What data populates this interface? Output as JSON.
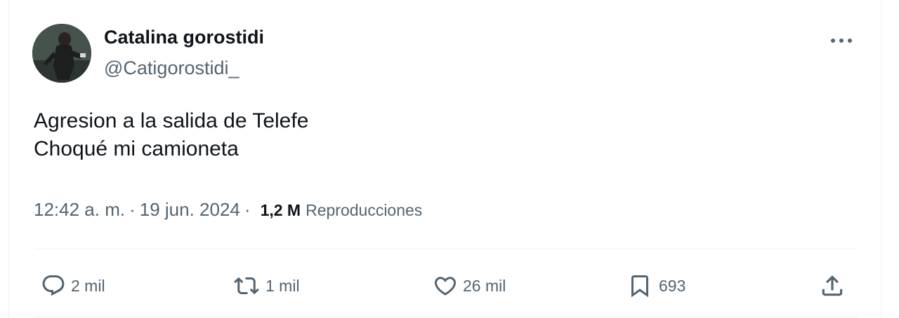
{
  "author": {
    "display_name": "Catalina gorostidi",
    "handle": "@Catigorostidi_"
  },
  "tweet": {
    "lines": [
      "Agresion a la salida de Telefe",
      "Choqué mi camioneta"
    ]
  },
  "meta": {
    "time": "12:42 a. m.",
    "separator": "·",
    "date": "19 jun. 2024",
    "views_count": "1,2 M",
    "views_label": "Reproducciones"
  },
  "actions": {
    "replies": "2 mil",
    "reposts": "1 mil",
    "likes": "26 mil",
    "bookmarks": "693"
  },
  "icons": {
    "more": "more-dots-icon",
    "reply": "reply-bubble-icon",
    "repost": "repost-arrows-icon",
    "like": "heart-icon",
    "bookmark": "bookmark-icon",
    "share": "share-upload-icon"
  },
  "colors": {
    "text_primary": "#0f1419",
    "text_secondary": "#536471",
    "divider": "#eff3f4"
  }
}
